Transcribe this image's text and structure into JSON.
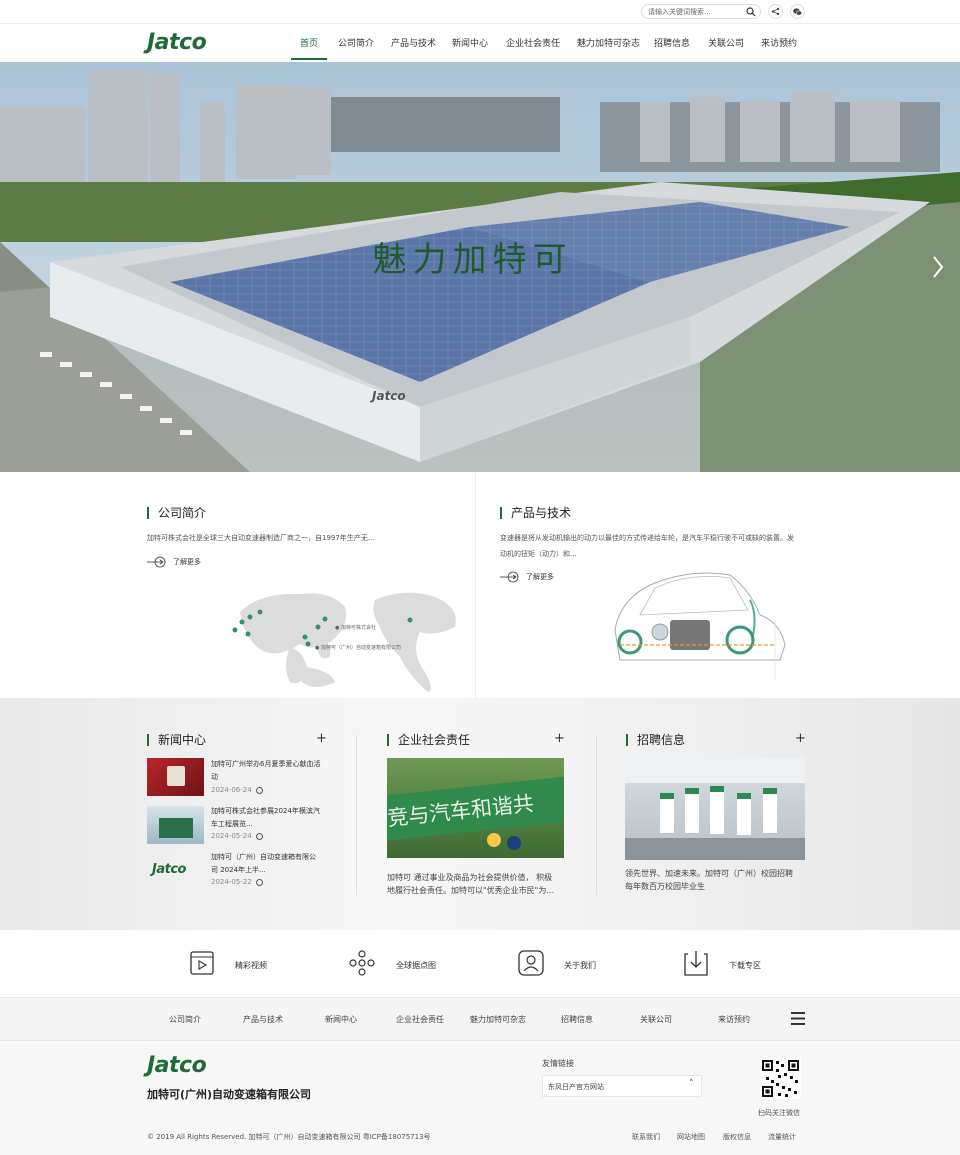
{
  "topbar": {
    "search_placeholder": "请输入关键词搜索...",
    "icons": [
      "search-icon",
      "share-icon",
      "wechat-icon"
    ]
  },
  "brand": {
    "logo_text": "Jatco",
    "accent": "#1f6b35"
  },
  "nav": {
    "items": [
      {
        "label": "首页",
        "active": true
      },
      {
        "label": "公司简介"
      },
      {
        "label": "产品与技术"
      },
      {
        "label": "新闻中心"
      },
      {
        "label": "企业社会责任"
      },
      {
        "label": "魅力加特可杂志"
      },
      {
        "label": "招聘信息"
      },
      {
        "label": "关联公司"
      },
      {
        "label": "来访预约"
      }
    ]
  },
  "hero": {
    "title": "魅力加特可",
    "slides": 6,
    "building_logo": "Jatco"
  },
  "intro": {
    "company": {
      "title": "公司简介",
      "desc": "加特可株式会社是全球三大自动变速器制造厂商之一，自1997年生产无...",
      "more": "了解更多",
      "map_labels": [
        "● 加特可株式会社",
        "● 加特可（广州）自动变速箱有限公司"
      ]
    },
    "product": {
      "title": "产品与技术",
      "desc_line1": "变速器是将从发动机输出的动力以最佳的方式传递给车轮，是汽车平稳行驶不可或缺的装置。发",
      "desc_line2": "动机的扭矩（动力）和...",
      "more": "了解更多"
    }
  },
  "news": {
    "title": "新闻中心",
    "plus": "+",
    "items": [
      {
        "title_l1": "加特可广州举办6月夏季爱心献血活",
        "title_l2": "动",
        "date": "2024-06-24"
      },
      {
        "title_l1": "加特可株式会社参展2024年横滨汽",
        "title_l2": "车工程展览...",
        "date": "2024-05-24"
      },
      {
        "title_l1": "加特可（广州）自动变速箱有限公",
        "title_l2": "司 2024年上半...",
        "date": "2024-05-22"
      }
    ]
  },
  "csr": {
    "title": "企业社会责任",
    "plus": "+",
    "banner_text": "竞与汽车和谐共",
    "text_l1": "加特可 通过事业及商品为社会提供价值， 积极",
    "text_l2": "地履行社会责任。加特可以\"优秀企业市民\"为..."
  },
  "recruit": {
    "title": "招聘信息",
    "plus": "+",
    "text_l1": "领先世界、加速未来。加特可（广州）校园招聘",
    "text_l2": "每年数百万校园毕业生"
  },
  "quick_links": [
    {
      "label": "精彩视频",
      "icon": "video-icon"
    },
    {
      "label": "全球据点图",
      "icon": "network-icon"
    },
    {
      "label": "关于我们",
      "icon": "person-icon"
    },
    {
      "label": "下载专区",
      "icon": "download-icon"
    }
  ],
  "footer_nav": [
    "公司简介",
    "产品与技术",
    "新闻中心",
    "企业社会责任",
    "魅力加特可杂志",
    "招聘信息",
    "关联公司",
    "来访预约"
  ],
  "footer": {
    "company_name": "加特可(广州)自动变速箱有限公司",
    "links_title": "友情链接",
    "links_select": "东风日产官方网站",
    "qr_caption": "扫码关注微信",
    "copyright": "© 2019 All Rights Reserved. 加特可（广州）自动变速箱有限公司 粤ICP备18075713号",
    "bottom_links": [
      "联系我们",
      "网站地图",
      "版权信息",
      "流量统计"
    ]
  }
}
